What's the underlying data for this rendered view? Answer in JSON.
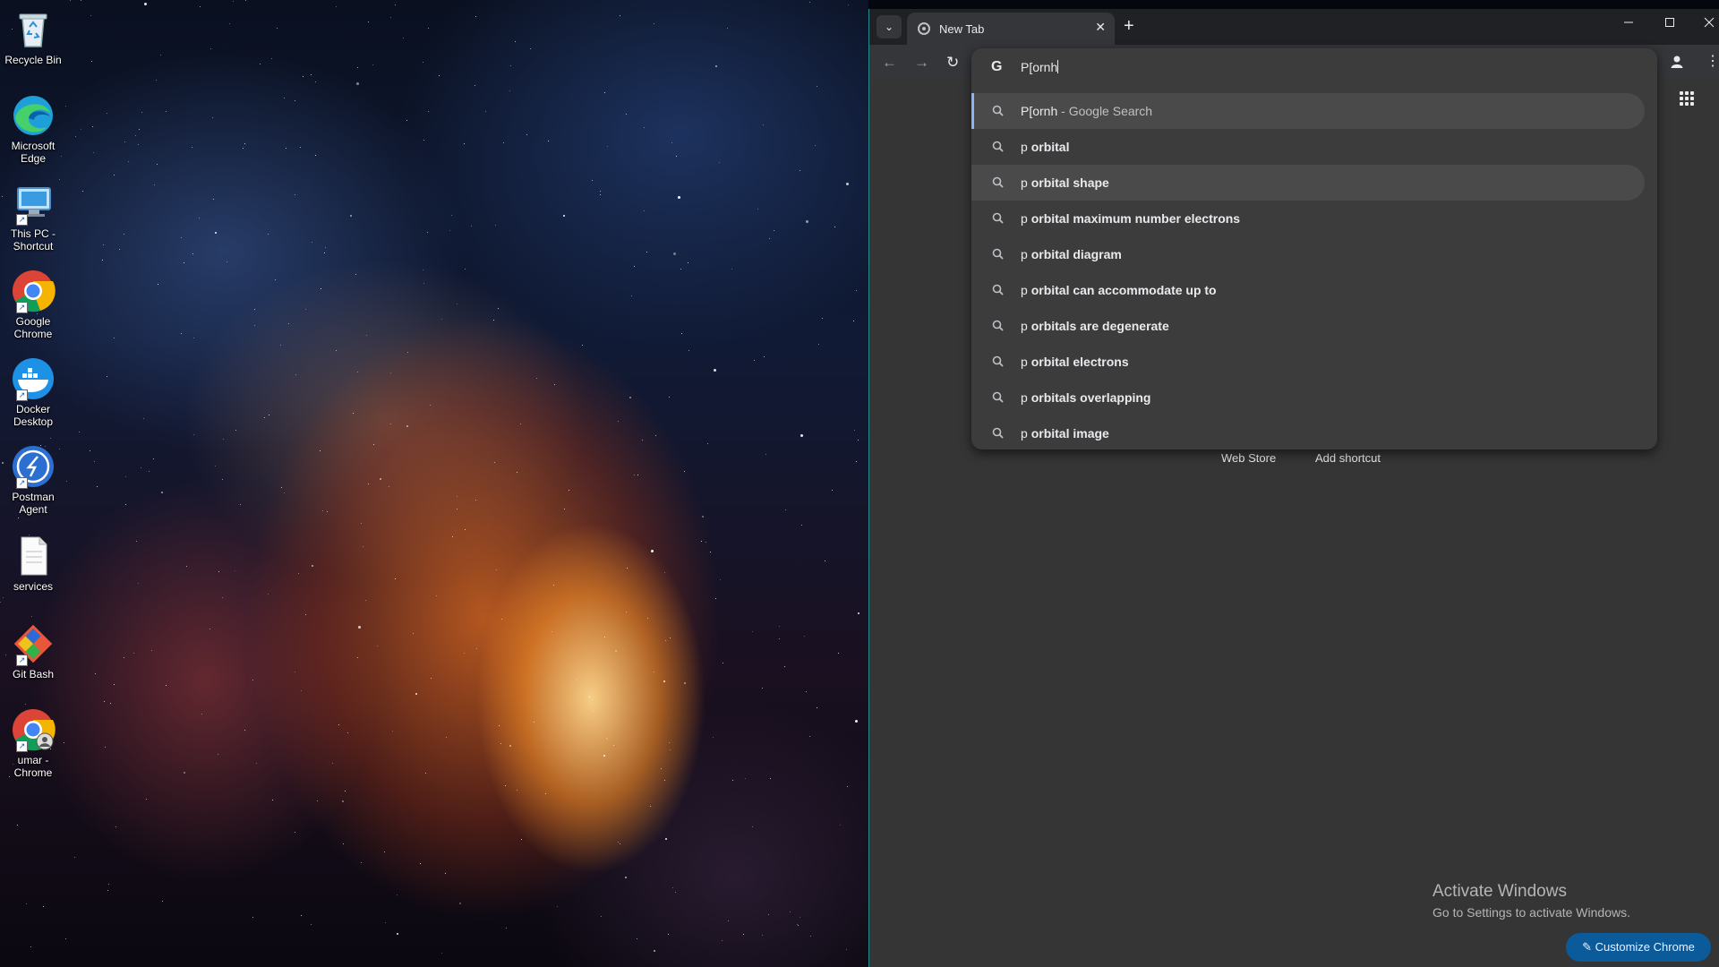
{
  "desktop": {
    "icons": [
      {
        "label": "Recycle Bin"
      },
      {
        "label": "Microsoft Edge"
      },
      {
        "label": "This PC - Shortcut"
      },
      {
        "label": "Google Chrome"
      },
      {
        "label": "Docker Desktop"
      },
      {
        "label": "Postman Agent"
      },
      {
        "label": "services"
      },
      {
        "label": "Git Bash"
      },
      {
        "label": "umar - Chrome"
      }
    ]
  },
  "browser": {
    "tab_title": "New Tab",
    "new_tab_symbol": "+",
    "tab_close_symbol": "✕",
    "omnibox": {
      "query": "P[ornh",
      "suggestions": [
        {
          "prefix": "P[ornh",
          "rest": "",
          "suffix": " - Google Search"
        },
        {
          "prefix": "p ",
          "rest": "orbital",
          "suffix": ""
        },
        {
          "prefix": "p ",
          "rest": "orbital shape",
          "suffix": ""
        },
        {
          "prefix": "p ",
          "rest": "orbital maximum number electrons",
          "suffix": ""
        },
        {
          "prefix": "p ",
          "rest": "orbital diagram",
          "suffix": ""
        },
        {
          "prefix": "p ",
          "rest": "orbital can accommodate up to",
          "suffix": ""
        },
        {
          "prefix": "p ",
          "rest": "orbitals are degenerate",
          "suffix": ""
        },
        {
          "prefix": "p ",
          "rest": "orbital electrons",
          "suffix": ""
        },
        {
          "prefix": "p ",
          "rest": "orbitals overlapping",
          "suffix": ""
        },
        {
          "prefix": "p ",
          "rest": "orbital image",
          "suffix": ""
        }
      ]
    },
    "ntp": {
      "web_store": "Web Store",
      "add_shortcut": "Add shortcut",
      "customize": "Customize Chrome"
    }
  },
  "watermark": {
    "line1": "Activate Windows",
    "line2": "Go to Settings to activate Windows."
  },
  "colors": {
    "accent": "#8ab4f8",
    "customize_button": "#0b5a9a"
  }
}
